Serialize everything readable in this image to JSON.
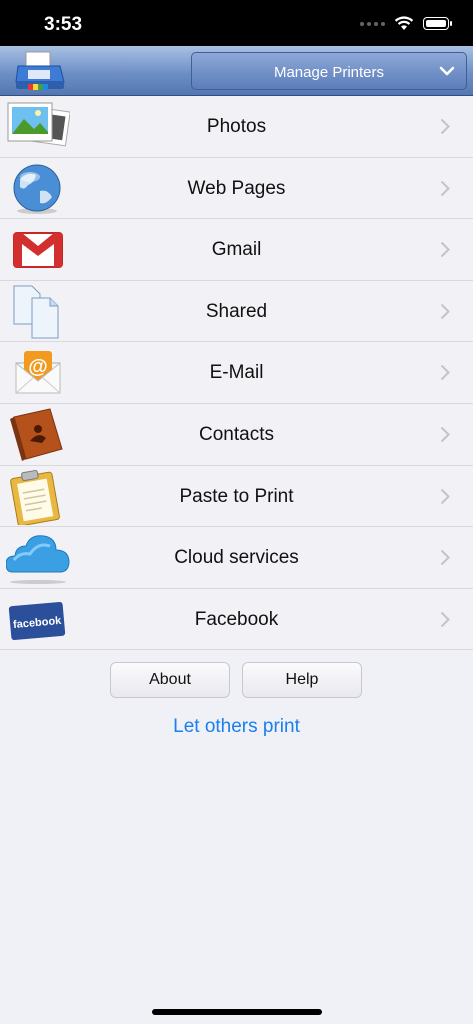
{
  "status": {
    "time": "3:53"
  },
  "toolbar": {
    "manage_label": "Manage Printers"
  },
  "menu": {
    "items": [
      {
        "label": "Photos",
        "icon": "photos-icon"
      },
      {
        "label": "Web Pages",
        "icon": "globe-icon"
      },
      {
        "label": "Gmail",
        "icon": "gmail-icon"
      },
      {
        "label": "Shared",
        "icon": "shared-documents-icon"
      },
      {
        "label": "E-Mail",
        "icon": "email-envelope-icon"
      },
      {
        "label": "Contacts",
        "icon": "contacts-book-icon"
      },
      {
        "label": "Paste to Print",
        "icon": "clipboard-icon"
      },
      {
        "label": "Cloud services",
        "icon": "cloud-icon"
      },
      {
        "label": "Facebook",
        "icon": "facebook-icon"
      }
    ]
  },
  "buttons": {
    "about": "About",
    "help": "Help"
  },
  "link": {
    "let_others_print": "Let others print"
  },
  "colors": {
    "accent": "#1a7ff0",
    "toolbar": "#6e8fc6",
    "background": "#f0f1f6"
  }
}
